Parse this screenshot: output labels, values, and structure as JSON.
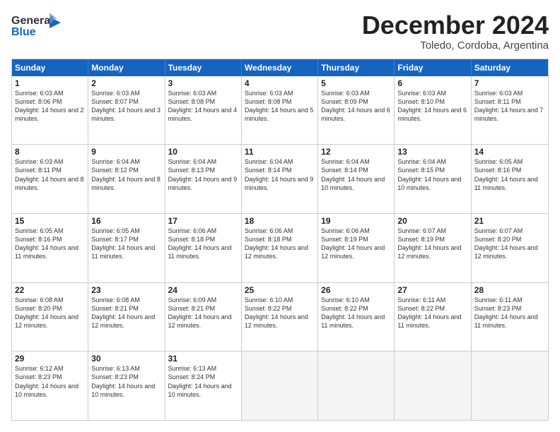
{
  "logo": {
    "line1": "General",
    "line2": "Blue"
  },
  "title": "December 2024",
  "subtitle": "Toledo, Cordoba, Argentina",
  "headers": [
    "Sunday",
    "Monday",
    "Tuesday",
    "Wednesday",
    "Thursday",
    "Friday",
    "Saturday"
  ],
  "rows": [
    [
      {
        "day": "1",
        "sunrise": "Sunrise: 6:03 AM",
        "sunset": "Sunset: 8:06 PM",
        "daylight": "Daylight: 14 hours and 2 minutes."
      },
      {
        "day": "2",
        "sunrise": "Sunrise: 6:03 AM",
        "sunset": "Sunset: 8:07 PM",
        "daylight": "Daylight: 14 hours and 3 minutes."
      },
      {
        "day": "3",
        "sunrise": "Sunrise: 6:03 AM",
        "sunset": "Sunset: 8:08 PM",
        "daylight": "Daylight: 14 hours and 4 minutes."
      },
      {
        "day": "4",
        "sunrise": "Sunrise: 6:03 AM",
        "sunset": "Sunset: 8:08 PM",
        "daylight": "Daylight: 14 hours and 5 minutes."
      },
      {
        "day": "5",
        "sunrise": "Sunrise: 6:03 AM",
        "sunset": "Sunset: 8:09 PM",
        "daylight": "Daylight: 14 hours and 6 minutes."
      },
      {
        "day": "6",
        "sunrise": "Sunrise: 6:03 AM",
        "sunset": "Sunset: 8:10 PM",
        "daylight": "Daylight: 14 hours and 6 minutes."
      },
      {
        "day": "7",
        "sunrise": "Sunrise: 6:03 AM",
        "sunset": "Sunset: 8:11 PM",
        "daylight": "Daylight: 14 hours and 7 minutes."
      }
    ],
    [
      {
        "day": "8",
        "sunrise": "Sunrise: 6:03 AM",
        "sunset": "Sunset: 8:11 PM",
        "daylight": "Daylight: 14 hours and 8 minutes."
      },
      {
        "day": "9",
        "sunrise": "Sunrise: 6:04 AM",
        "sunset": "Sunset: 8:12 PM",
        "daylight": "Daylight: 14 hours and 8 minutes."
      },
      {
        "day": "10",
        "sunrise": "Sunrise: 6:04 AM",
        "sunset": "Sunset: 8:13 PM",
        "daylight": "Daylight: 14 hours and 9 minutes."
      },
      {
        "day": "11",
        "sunrise": "Sunrise: 6:04 AM",
        "sunset": "Sunset: 8:14 PM",
        "daylight": "Daylight: 14 hours and 9 minutes."
      },
      {
        "day": "12",
        "sunrise": "Sunrise: 6:04 AM",
        "sunset": "Sunset: 8:14 PM",
        "daylight": "Daylight: 14 hours and 10 minutes."
      },
      {
        "day": "13",
        "sunrise": "Sunrise: 6:04 AM",
        "sunset": "Sunset: 8:15 PM",
        "daylight": "Daylight: 14 hours and 10 minutes."
      },
      {
        "day": "14",
        "sunrise": "Sunrise: 6:05 AM",
        "sunset": "Sunset: 8:16 PM",
        "daylight": "Daylight: 14 hours and 11 minutes."
      }
    ],
    [
      {
        "day": "15",
        "sunrise": "Sunrise: 6:05 AM",
        "sunset": "Sunset: 8:16 PM",
        "daylight": "Daylight: 14 hours and 11 minutes."
      },
      {
        "day": "16",
        "sunrise": "Sunrise: 6:05 AM",
        "sunset": "Sunset: 8:17 PM",
        "daylight": "Daylight: 14 hours and 11 minutes."
      },
      {
        "day": "17",
        "sunrise": "Sunrise: 6:06 AM",
        "sunset": "Sunset: 8:18 PM",
        "daylight": "Daylight: 14 hours and 11 minutes."
      },
      {
        "day": "18",
        "sunrise": "Sunrise: 6:06 AM",
        "sunset": "Sunset: 8:18 PM",
        "daylight": "Daylight: 14 hours and 12 minutes."
      },
      {
        "day": "19",
        "sunrise": "Sunrise: 6:06 AM",
        "sunset": "Sunset: 8:19 PM",
        "daylight": "Daylight: 14 hours and 12 minutes."
      },
      {
        "day": "20",
        "sunrise": "Sunrise: 6:07 AM",
        "sunset": "Sunset: 8:19 PM",
        "daylight": "Daylight: 14 hours and 12 minutes."
      },
      {
        "day": "21",
        "sunrise": "Sunrise: 6:07 AM",
        "sunset": "Sunset: 8:20 PM",
        "daylight": "Daylight: 14 hours and 12 minutes."
      }
    ],
    [
      {
        "day": "22",
        "sunrise": "Sunrise: 6:08 AM",
        "sunset": "Sunset: 8:20 PM",
        "daylight": "Daylight: 14 hours and 12 minutes."
      },
      {
        "day": "23",
        "sunrise": "Sunrise: 6:08 AM",
        "sunset": "Sunset: 8:21 PM",
        "daylight": "Daylight: 14 hours and 12 minutes."
      },
      {
        "day": "24",
        "sunrise": "Sunrise: 6:09 AM",
        "sunset": "Sunset: 8:21 PM",
        "daylight": "Daylight: 14 hours and 12 minutes."
      },
      {
        "day": "25",
        "sunrise": "Sunrise: 6:10 AM",
        "sunset": "Sunset: 8:22 PM",
        "daylight": "Daylight: 14 hours and 12 minutes."
      },
      {
        "day": "26",
        "sunrise": "Sunrise: 6:10 AM",
        "sunset": "Sunset: 8:22 PM",
        "daylight": "Daylight: 14 hours and 11 minutes."
      },
      {
        "day": "27",
        "sunrise": "Sunrise: 6:11 AM",
        "sunset": "Sunset: 8:22 PM",
        "daylight": "Daylight: 14 hours and 11 minutes."
      },
      {
        "day": "28",
        "sunrise": "Sunrise: 6:11 AM",
        "sunset": "Sunset: 8:23 PM",
        "daylight": "Daylight: 14 hours and 11 minutes."
      }
    ],
    [
      {
        "day": "29",
        "sunrise": "Sunrise: 6:12 AM",
        "sunset": "Sunset: 8:23 PM",
        "daylight": "Daylight: 14 hours and 10 minutes."
      },
      {
        "day": "30",
        "sunrise": "Sunrise: 6:13 AM",
        "sunset": "Sunset: 8:23 PM",
        "daylight": "Daylight: 14 hours and 10 minutes."
      },
      {
        "day": "31",
        "sunrise": "Sunrise: 6:13 AM",
        "sunset": "Sunset: 8:24 PM",
        "daylight": "Daylight: 14 hours and 10 minutes."
      },
      null,
      null,
      null,
      null
    ]
  ]
}
